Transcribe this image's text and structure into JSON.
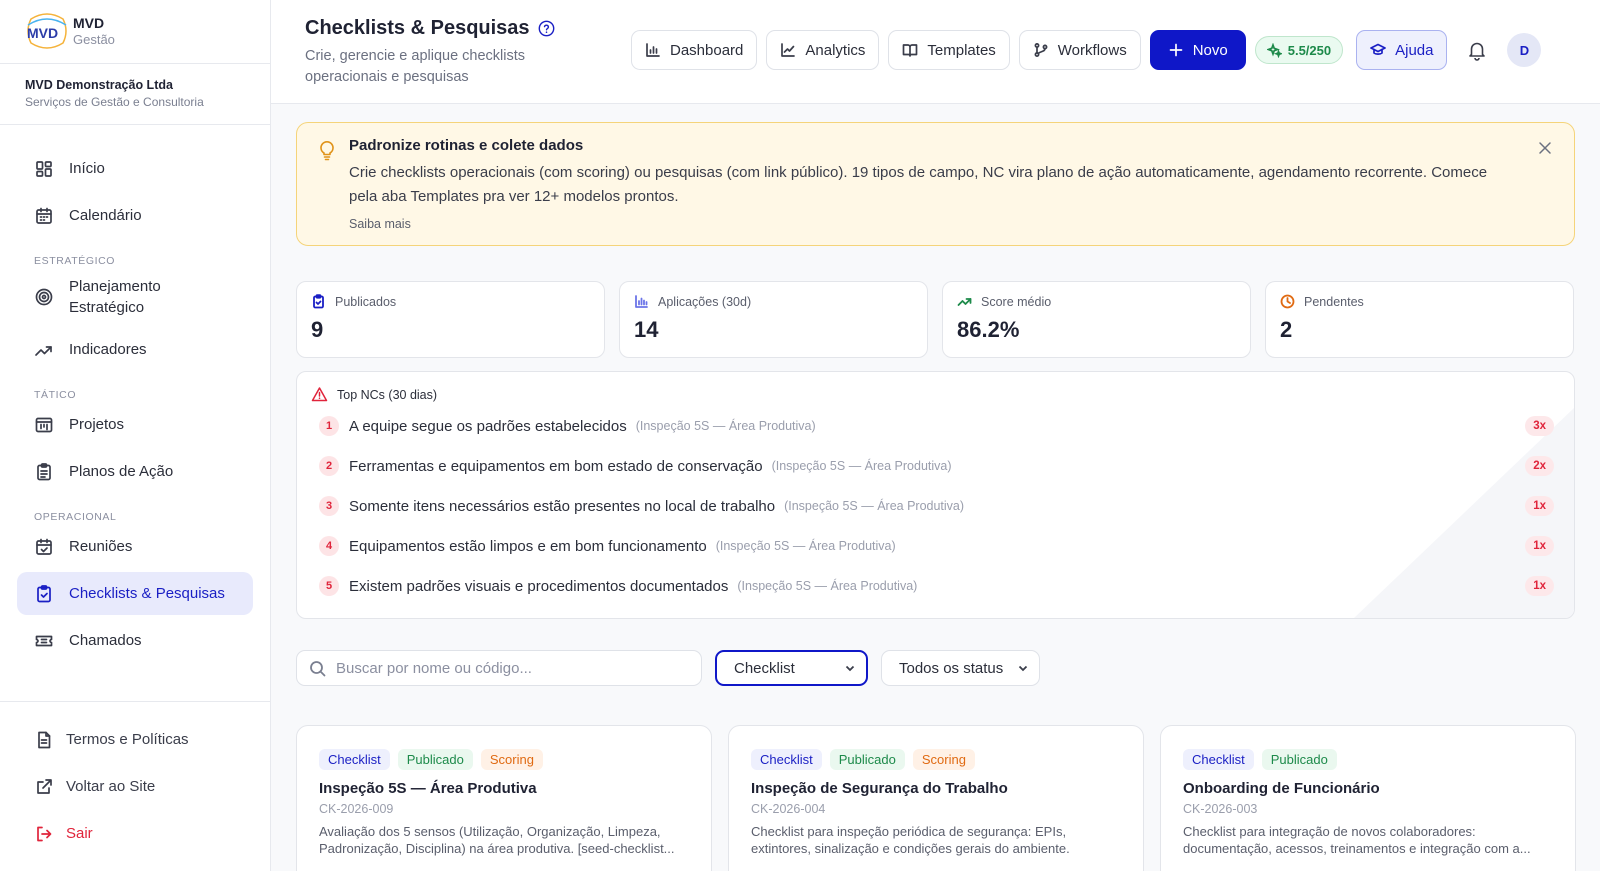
{
  "brand": {
    "name": "MVD",
    "sub": "Gestão",
    "logo_text": "MVD"
  },
  "org": {
    "name": "MVD Demonstração Ltda",
    "sub": "Serviços de Gestão e Consultoria"
  },
  "nav": {
    "inicio": "Início",
    "calendario": "Calendário",
    "section_estrategico": "ESTRATÉGICO",
    "planejamento": "Planejamento Estratégico",
    "indicadores": "Indicadores",
    "section_tatico": "TÁTICO",
    "projetos": "Projetos",
    "planos": "Planos de Ação",
    "section_operacional": "OPERACIONAL",
    "reunioes": "Reuniões",
    "checklists": "Checklists & Pesquisas",
    "chamados": "Chamados"
  },
  "side_bottom": {
    "termos": "Termos e Políticas",
    "voltar": "Voltar ao Site",
    "sair": "Sair"
  },
  "header": {
    "title": "Checklists & Pesquisas",
    "subtitle": "Crie, gerencie e aplique checklists operacionais e pesquisas",
    "dashboard": "Dashboard",
    "analytics": "Analytics",
    "templates": "Templates",
    "workflows": "Workflows",
    "novo": "Novo",
    "score": "5.5/250",
    "ajuda": "Ajuda",
    "avatar": "D"
  },
  "banner": {
    "title": "Padronize rotinas e colete dados",
    "text": "Crie checklists operacionais (com scoring) ou pesquisas (com link público). 19 tipos de campo, NC vira plano de ação automaticamente, agendamento recorrente. Comece pela aba Templates pra ver 12+ modelos prontos.",
    "link": "Saiba mais"
  },
  "stats": [
    {
      "label": "Publicados",
      "value": "9",
      "icon": "clipboard-check-icon",
      "color": "#1a1fc4"
    },
    {
      "label": "Aplicações (30d)",
      "value": "14",
      "icon": "bar-chart-icon",
      "color": "#6b74e8"
    },
    {
      "label": "Score médio",
      "value": "86.2%",
      "icon": "trending-up-icon",
      "color": "#1d8a4a"
    },
    {
      "label": "Pendentes",
      "value": "2",
      "icon": "clock-icon",
      "color": "#e06a12"
    }
  ],
  "top_ncs": {
    "title": "Top NCs (30 dias)",
    "items": [
      {
        "rank": "1",
        "text": "A equipe segue os padrões estabelecidos",
        "source": "(Inspeção 5S — Área Produtiva)",
        "count": "3x"
      },
      {
        "rank": "2",
        "text": "Ferramentas e equipamentos em bom estado de conservação",
        "source": "(Inspeção 5S — Área Produtiva)",
        "count": "2x"
      },
      {
        "rank": "3",
        "text": "Somente itens necessários estão presentes no local de trabalho",
        "source": "(Inspeção 5S — Área Produtiva)",
        "count": "1x"
      },
      {
        "rank": "4",
        "text": "Equipamentos estão limpos e em bom funcionamento",
        "source": "(Inspeção 5S — Área Produtiva)",
        "count": "1x"
      },
      {
        "rank": "5",
        "text": "Existem padrões visuais e procedimentos documentados",
        "source": "(Inspeção 5S — Área Produtiva)",
        "count": "1x"
      }
    ]
  },
  "filters": {
    "search_placeholder": "Buscar por nome ou código...",
    "search_value": "",
    "type_selected": "Checklist",
    "status_selected": "Todos os status"
  },
  "cards": [
    {
      "badges": [
        "Checklist",
        "Publicado",
        "Scoring"
      ],
      "title": "Inspeção 5S — Área Produtiva",
      "code": "CK-2026-009",
      "desc": "Avaliação dos 5 sensos (Utilização, Organização, Limpeza, Padronização, Disciplina) na área produtiva. [seed-checklist..."
    },
    {
      "badges": [
        "Checklist",
        "Publicado",
        "Scoring"
      ],
      "title": "Inspeção de Segurança do Trabalho",
      "code": "CK-2026-004",
      "desc": "Checklist para inspeção periódica de segurança: EPIs, extintores, sinalização e condições gerais do ambiente."
    },
    {
      "badges": [
        "Checklist",
        "Publicado"
      ],
      "title": "Onboarding de Funcionário",
      "code": "CK-2026-003",
      "desc": "Checklist para integração de novos colaboradores: documentação, acessos, treinamentos e integração com a..."
    }
  ],
  "colors": {
    "primary": "#0f17c8",
    "active_bg": "#e8eafc",
    "danger": "#e0243b",
    "banner_bg": "#fff8e6",
    "banner_border": "#f5d47a"
  }
}
